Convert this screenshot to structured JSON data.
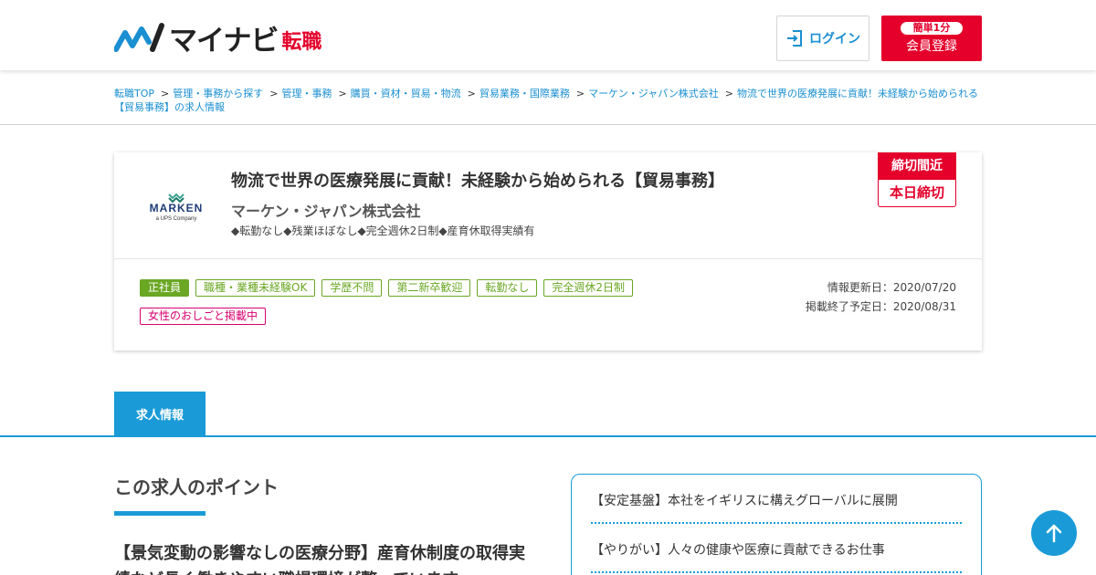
{
  "header": {
    "logo_text": "マイナビ",
    "logo_sub": "転職",
    "login_label": "ログイン",
    "register_pill": "簡単1分",
    "register_label": "会員登録",
    "brand_color": "#e4002b",
    "accent_color": "#1a8fd1"
  },
  "breadcrumb": [
    "転職TOP",
    "管理・事務から探す",
    "管理・事務",
    "購買・資材・貿易・物流",
    "貿易業務・国際業務",
    "マーケン・ジャパン株式会社",
    "物流で世界の医療発展に貢献！未経験から始められる【貿易事務】の求人情報"
  ],
  "job": {
    "title": "物流で世界の医療発展に貢献！未経験から始められる【貿易事務】",
    "company": "マーケン・ジャパン株式会社",
    "features": "◆転勤なし◆残業ほぼなし◆完全週休2日制◆産育休取得実績有",
    "company_logo_text": "MARKEN",
    "company_logo_sub": "a UPS Company",
    "deadline_top": "締切間近",
    "deadline_bottom": "本日締切",
    "tags": [
      {
        "label": "正社員",
        "style": "filled"
      },
      {
        "label": "職種・業種未経験OK",
        "style": "outline"
      },
      {
        "label": "学歴不問",
        "style": "outline"
      },
      {
        "label": "第二新卒歓迎",
        "style": "outline"
      },
      {
        "label": "転勤なし",
        "style": "outline"
      },
      {
        "label": "完全週休2日制",
        "style": "outline"
      },
      {
        "label": "女性のおしごと掲載中",
        "style": "pink"
      }
    ],
    "updated": "情報更新日：2020/07/20",
    "end_date": "掲載終了予定日：2020/08/31"
  },
  "tabs": {
    "active": "求人情報"
  },
  "content": {
    "section_heading": "この求人のポイント",
    "point_text": "【景気変動の影響なしの医療分野】産育休制度の取得実績など長く働きやすい職場環境が整っています",
    "points": [
      "【安定基盤】本社をイギリスに構えグローバルに展開",
      "【やりがい】人々の健康や医療に貢献できるお仕事"
    ]
  }
}
